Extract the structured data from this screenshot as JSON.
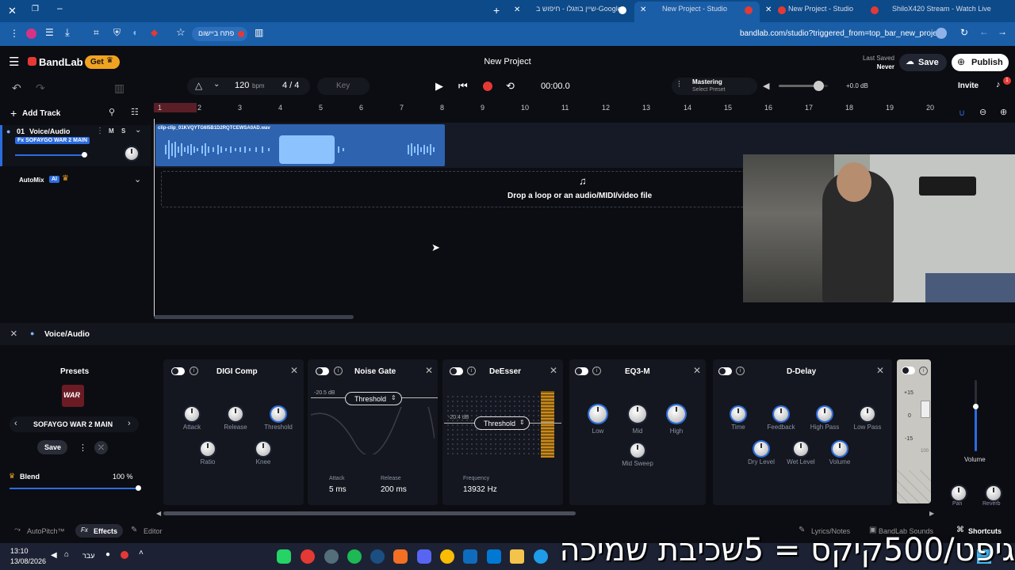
{
  "browser": {
    "tabs": [
      {
        "label": "שיין בוזגלו - חיפוש ב-Google"
      },
      {
        "label": "New Project - Studio"
      },
      {
        "label": "New Project - Studio"
      },
      {
        "label": "ShiloX420 Stream - Watch Live"
      }
    ],
    "bookmark_label": "פתח ביישום",
    "url": "bandlab.com/studio?triggered_from=top_bar_new_project"
  },
  "header": {
    "brand": "BandLab",
    "get_label": "Get",
    "project_title": "New Project",
    "last_saved_label": "Last Saved",
    "last_saved_value": "Never",
    "save_label": "Save",
    "publish_label": "Publish"
  },
  "transport": {
    "bpm": "120",
    "bpm_unit": "bpm",
    "time_sig": "4 / 4",
    "key_label": "Key",
    "time": "00:00.0",
    "mastering_label": "Mastering",
    "mastering_preset": "Select Preset",
    "master_db": "+0.0 dB",
    "volume_fraction": 0.8,
    "invite_label": "Invite",
    "notification_count": "1"
  },
  "tracks": {
    "add_track_label": "Add Track",
    "track_number": "01",
    "track_name": "Voice/Audio",
    "mute": "M",
    "solo": "S",
    "effect_chip": "Fx SOFAYGO WAR 2 MAIN",
    "automix_label": "AutoMix",
    "automix_badge": "AI",
    "clip_name": "clip-clip_01KVQYTG6I5B1D2RQTCEWSA0AD.wav",
    "drop_text": "Drop a loop or an audio/MIDI/video file"
  },
  "timeline": {
    "ticks": [
      "1",
      "2",
      "3",
      "4",
      "5",
      "6",
      "7",
      "8",
      "9",
      "10",
      "11",
      "12",
      "13",
      "14",
      "15",
      "16",
      "17",
      "18",
      "19",
      "20"
    ]
  },
  "panel": {
    "close": "×",
    "track_label": "Voice/Audio",
    "presets_label": "Presets",
    "preset_name": "SOFAYGO WAR 2 MAIN",
    "preset_logo_text": "WAR",
    "save_label": "Save",
    "blend_label": "Blend",
    "blend_value": "100 %",
    "blend_fraction": 1.0
  },
  "effects": {
    "digi_comp": {
      "title": "DIGI Comp",
      "knobs": [
        "Attack",
        "Release",
        "Threshold",
        "Ratio",
        "Knee"
      ]
    },
    "noise_gate": {
      "title": "Noise Gate",
      "db": "-20.5 dB",
      "param": "Threshold",
      "attack_label": "Attack",
      "attack_value": "5 ms",
      "release_label": "Release",
      "release_value": "200 ms"
    },
    "deesser": {
      "title": "DeEsser",
      "db": "-20.4 dB",
      "param": "Threshold",
      "freq_label": "Frequency",
      "freq_value": "13932 Hz"
    },
    "eq3m": {
      "title": "EQ3-M",
      "knobs": [
        "Low",
        "Mid",
        "High",
        "Mid Sweep"
      ]
    },
    "ddelay": {
      "title": "D-Delay",
      "knobs": [
        "Time",
        "Feedback",
        "High Pass",
        "Low Pass",
        "Dry Level",
        "Wet Level",
        "Volume"
      ]
    },
    "meter": {
      "scale": [
        "+15",
        "0",
        "-15"
      ],
      "vol_marker": "100"
    }
  },
  "mixer": {
    "volume_label": "Volume",
    "pan_label": "Pan",
    "reverb_label": "Reverb",
    "volume_fraction": 0.63
  },
  "bottom_bar": {
    "autopitch_label": "AutoPitch™",
    "effects_label": "Effects",
    "editor_label": "Editor",
    "lyrics_label": "Lyrics/Notes",
    "sounds_label": "BandLab Sounds",
    "shortcuts_label": "Shortcuts"
  },
  "taskbar": {
    "time": "13:10",
    "date": "13/08/2026",
    "lang": "עבר"
  },
  "overlay_text": "גיפט/500קיקס = 5שכיבת שמיכה",
  "colors": {
    "accent_blue": "#2b6de0",
    "record_red": "#e53935",
    "brand_orange": "#f0a321",
    "clip_blue": "#3b86e0"
  }
}
